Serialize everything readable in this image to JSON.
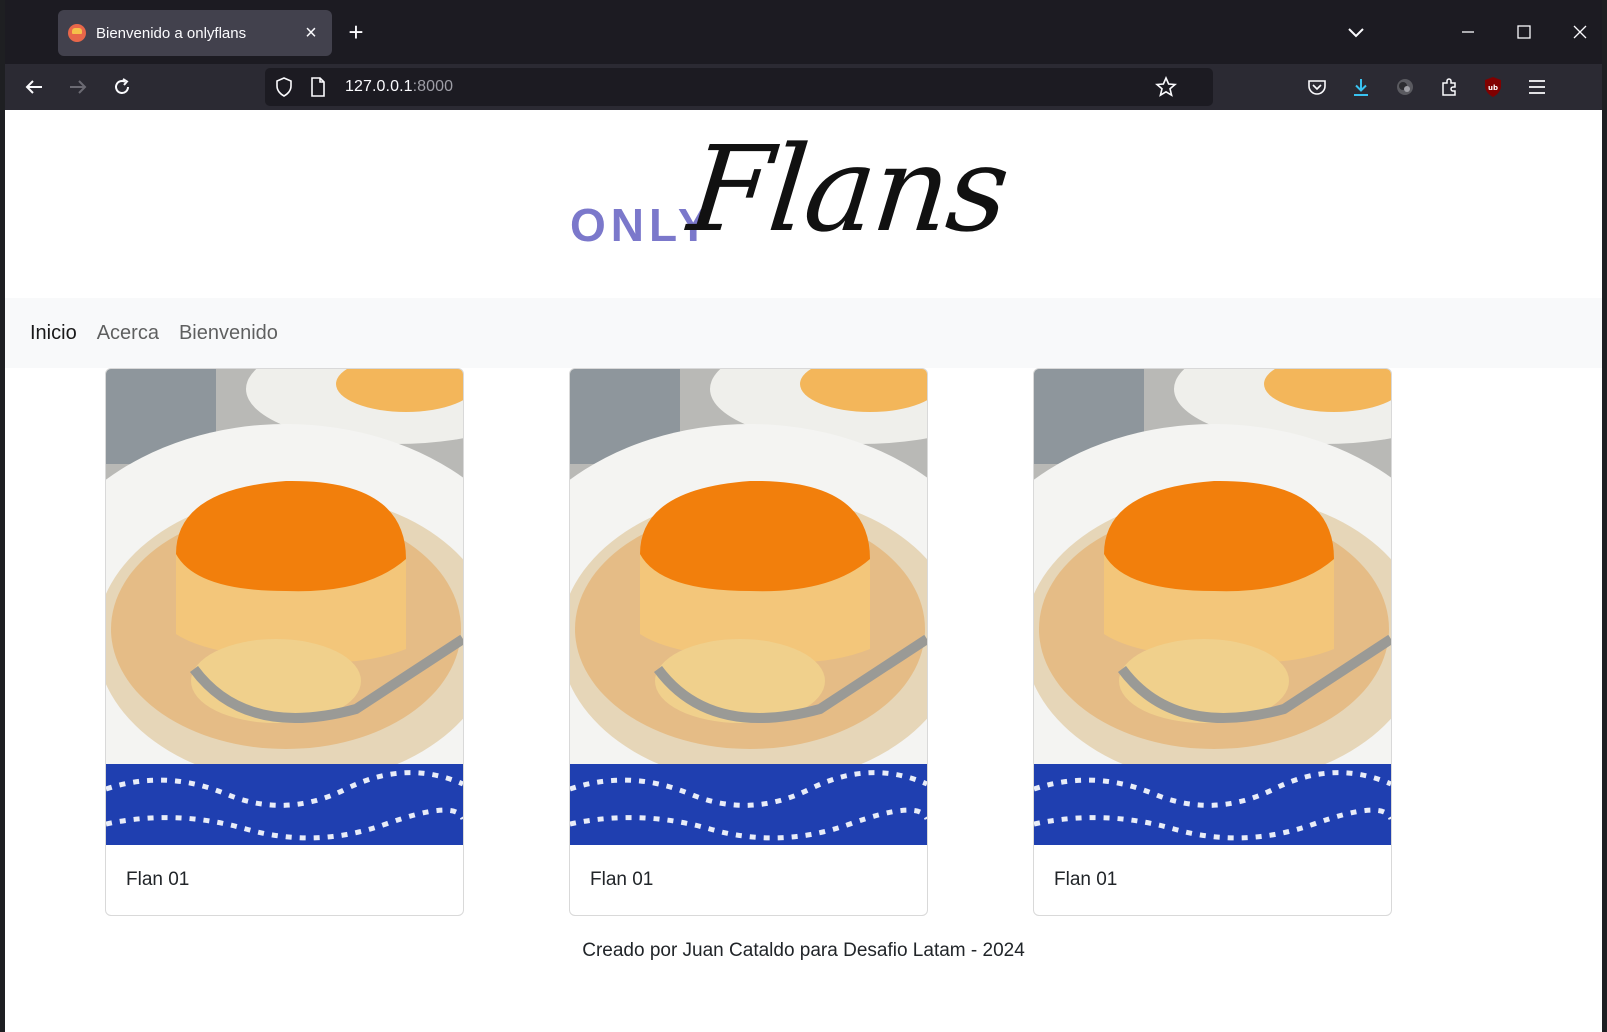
{
  "browser": {
    "tab_title": "Bienvenido a onlyflans",
    "url_host": "127.0.0.1",
    "url_port": ":8000"
  },
  "site": {
    "logo_only": "ONLY",
    "logo_flans": "Flans",
    "nav": [
      {
        "label": "Inicio",
        "active": true
      },
      {
        "label": "Acerca",
        "active": false
      },
      {
        "label": "Bienvenido",
        "active": false
      }
    ],
    "cards": [
      {
        "title": "Flan 01"
      },
      {
        "title": "Flan 01"
      },
      {
        "title": "Flan 01"
      }
    ],
    "footer": "Creado por Juan Cataldo para Desafio Latam - 2024"
  },
  "colors": {
    "logo_only": "#7b78cb",
    "flan_top": "#f27f0c",
    "flan_body": "#f3c67a",
    "tablecloth": "#1f3fb0"
  }
}
